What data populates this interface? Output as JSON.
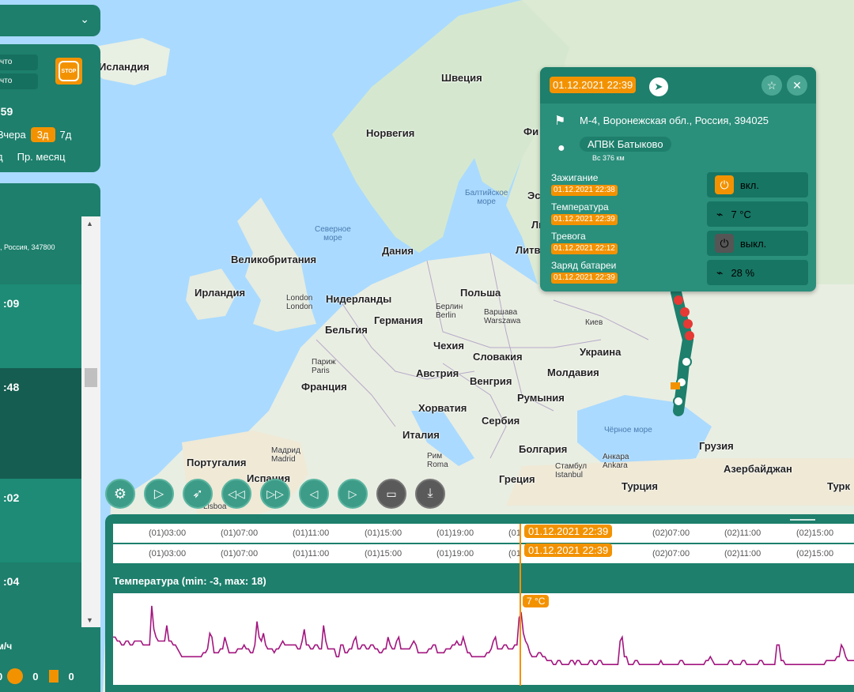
{
  "map": {
    "countries": [
      {
        "name": "Исландия"
      },
      {
        "name": "Швеция"
      },
      {
        "name": "Норвегия"
      },
      {
        "name": "Фи"
      },
      {
        "name": "Эс"
      },
      {
        "name": "Ли"
      },
      {
        "name": "Литв"
      },
      {
        "name": "Дания"
      },
      {
        "name": "Великобритания"
      },
      {
        "name": "Ирландия"
      },
      {
        "name": "Нидерланды"
      },
      {
        "name": "Германия"
      },
      {
        "name": "Польша"
      },
      {
        "name": "Бельгия"
      },
      {
        "name": "Чехия"
      },
      {
        "name": "Словакия"
      },
      {
        "name": "Украина"
      },
      {
        "name": "Франция"
      },
      {
        "name": "Австрия"
      },
      {
        "name": "Венгрия"
      },
      {
        "name": "Молдавия"
      },
      {
        "name": "Румыния"
      },
      {
        "name": "Хорватия"
      },
      {
        "name": "Сербия"
      },
      {
        "name": "Италия"
      },
      {
        "name": "Болгария"
      },
      {
        "name": "Грузия"
      },
      {
        "name": "Португалия"
      },
      {
        "name": "Испания"
      },
      {
        "name": "Греция"
      },
      {
        "name": "Турция"
      },
      {
        "name": "Азербайджан"
      },
      {
        "name": "Турк"
      }
    ],
    "seas": [
      {
        "name": "Балтийское\nморе"
      },
      {
        "name": "Северное\nморе"
      },
      {
        "name": "Чёрное море"
      }
    ],
    "cities": [
      {
        "name": "London\nLondon"
      },
      {
        "name": "Берлин\nBerlin"
      },
      {
        "name": "Варшава\nWarszawa"
      },
      {
        "name": "Киев"
      },
      {
        "name": "Париж\nParis"
      },
      {
        "name": "Мадрид\nMadrid"
      },
      {
        "name": "Рим\nRoma"
      },
      {
        "name": "Стамбул\nIstanbul"
      },
      {
        "name": "Анкара\nAnkara"
      },
      {
        "name": "Lisboa"
      }
    ]
  },
  "left_panel": {
    "top_btn1": "чтo",
    "top_btn2": "чтo",
    "stop_label": "STOP",
    "time_partial": ":59",
    "periods": [
      "Вчера",
      "3д",
      "7д"
    ],
    "period_active": "3д",
    "periods2": [
      "д",
      "Пр. месяц"
    ],
    "address_partial": ", Россия, 347800",
    "entries": [
      ":09",
      ":48",
      ":02",
      ":04"
    ],
    "speed_unit": "м/ч",
    "footer_vals": [
      "0",
      "0",
      "0"
    ]
  },
  "popup": {
    "datetime": "01.12.2021 22:39",
    "address": "М-4, Воронежская обл., Россия, 394025",
    "place": "АПВК Батыково",
    "distance": "Вс 376 км",
    "sensors": [
      {
        "name": "Зажигание",
        "time": "01.12.2021 22:38",
        "value": "вкл.",
        "icon": "power-icon"
      },
      {
        "name": "Температура",
        "time": "01.12.2021 22:39",
        "value": "7 °C",
        "icon": "pulse-icon"
      },
      {
        "name": "Тревога",
        "time": "01.12.2021 22:12",
        "value": "выкл.",
        "icon": "power-icon"
      },
      {
        "name": "Заряд батареи",
        "time": "01.12.2021 22:39",
        "value": "28 %",
        "icon": "pulse-icon"
      }
    ]
  },
  "controls": [
    "settings-icon",
    "play-icon",
    "rocket-icon",
    "rewind-icon",
    "fast-forward-icon",
    "prev-icon",
    "next-icon",
    "video-icon",
    "download-icon"
  ],
  "timeline": {
    "ticks": [
      "(01)03:00",
      "(01)07:00",
      "(01)11:00",
      "(01)15:00",
      "(01)19:00",
      "(01",
      "(02)07:00",
      "(02)11:00",
      "(02)15:00"
    ],
    "cursor_label": "01.12.2021 22:39",
    "chart_title": "Температура (min: -3, max: 18)",
    "cursor_value": "7 °C"
  },
  "chart_data": {
    "type": "line",
    "title": "Температура (min: -3, max: 18)",
    "ylim": [
      -3,
      18
    ],
    "series": [
      {
        "values": [
          8,
          8,
          7,
          7,
          6,
          6,
          7,
          7,
          6,
          6,
          7,
          7,
          7,
          7,
          6,
          6,
          6,
          6,
          16,
          10,
          8,
          7,
          7,
          7,
          7,
          11,
          7,
          7,
          6,
          6,
          5,
          4,
          3,
          3,
          3,
          3,
          3,
          3,
          3,
          3,
          3,
          3,
          4,
          4,
          5,
          9,
          8,
          4,
          4,
          4,
          5,
          5,
          8,
          6,
          4,
          4,
          4,
          4,
          5,
          5,
          5,
          6,
          5,
          5,
          4,
          4,
          6,
          12,
          8,
          7,
          9,
          6,
          5,
          5,
          5,
          4,
          5,
          5,
          6,
          7,
          6,
          6,
          6,
          6,
          6,
          6,
          5,
          5,
          7,
          10,
          6,
          6,
          5,
          5,
          6,
          6,
          5,
          5,
          11,
          7,
          5,
          5,
          5,
          5,
          3,
          3,
          6,
          6,
          4,
          4,
          5,
          5,
          7,
          8,
          5,
          5,
          6,
          6,
          5,
          5,
          6,
          6,
          5,
          5,
          4,
          4,
          5,
          5,
          8,
          6,
          5,
          5,
          7,
          8,
          5,
          5,
          5,
          5,
          5,
          6,
          7,
          6,
          4,
          4,
          4,
          4,
          4,
          5,
          5,
          6,
          6,
          4,
          4,
          4,
          4,
          5,
          5,
          5,
          6,
          6,
          7,
          6,
          6,
          8,
          6,
          4,
          4,
          3,
          3,
          3,
          3,
          3,
          3,
          3,
          4,
          4,
          5,
          7,
          8,
          5,
          5,
          5,
          6,
          6,
          5,
          5,
          5,
          6,
          6,
          13,
          14,
          9,
          7,
          6,
          4,
          3,
          3,
          3,
          4,
          4,
          3,
          3,
          2,
          2,
          2,
          1,
          1,
          2,
          2,
          1,
          1,
          1,
          1,
          2,
          2,
          1,
          2,
          2,
          1,
          1,
          1,
          1,
          2,
          2,
          1,
          1,
          2,
          2,
          1,
          1,
          1,
          1,
          1,
          1,
          1,
          1,
          7,
          8,
          3,
          3,
          1,
          1,
          1,
          2,
          2,
          1,
          1,
          1,
          1,
          1,
          1,
          1,
          1,
          1,
          1,
          2,
          1,
          1,
          1,
          1,
          1,
          1,
          1,
          1,
          2,
          2,
          1,
          1,
          1,
          1,
          1,
          1,
          1,
          1,
          1,
          1,
          2,
          2,
          3,
          2,
          1,
          1,
          1,
          1,
          1,
          1,
          1,
          2,
          2,
          1,
          1,
          1,
          1,
          2,
          2,
          1,
          1,
          1,
          1,
          1,
          1,
          2,
          2,
          1,
          1,
          1,
          1,
          1,
          1,
          6,
          6,
          2,
          2,
          1,
          1,
          1,
          1,
          1,
          1,
          1,
          1,
          1,
          1,
          1,
          1,
          1,
          1,
          1,
          1,
          1,
          1,
          1,
          2,
          2,
          2,
          2,
          2,
          3,
          3,
          6,
          5,
          3,
          2,
          2,
          2,
          2,
          2
        ]
      }
    ]
  },
  "colors": {
    "panel": "#1d7f6c",
    "accent": "#f39200",
    "series": "#a3157f"
  }
}
